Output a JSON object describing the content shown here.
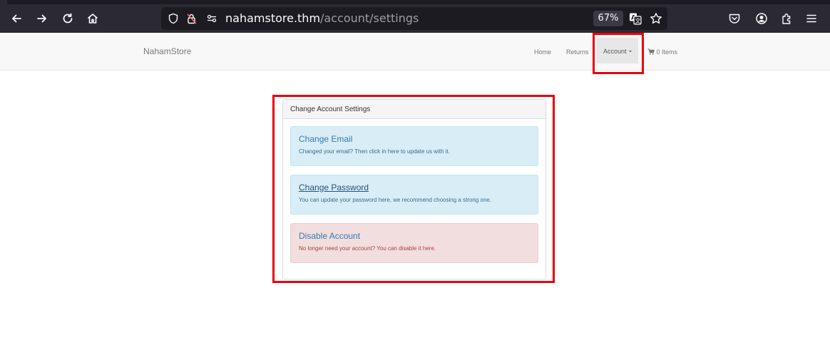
{
  "browser": {
    "url_host": "nahamstore.thm",
    "url_path": "/account/settings",
    "zoom": "67%"
  },
  "site": {
    "brand": "NahamStore",
    "nav": {
      "home": "Home",
      "returns": "Returns",
      "account": "Account",
      "basket": "0 Items"
    }
  },
  "panel": {
    "heading": "Change Account Settings",
    "options": [
      {
        "title": "Change Email",
        "description": "Changed your email? Then click in here to update us with it."
      },
      {
        "title": "Change Password",
        "description": "You can update your password here, we recommend choosing a strong one."
      },
      {
        "title": "Disable Account",
        "description": "No longer need your account? You can disable it here."
      }
    ]
  },
  "colors": {
    "annotation": "#e8000b",
    "info_bg": "#d9edf7",
    "danger_bg": "#f2dede",
    "link": "#337ab7"
  },
  "icons": [
    "back-icon",
    "forward-icon",
    "reload-icon",
    "home-icon",
    "shield-icon",
    "lock-warning-icon",
    "permissions-icon",
    "translate-icon",
    "bookmark-star-icon",
    "pocket-icon",
    "account-icon",
    "extensions-icon",
    "menu-icon",
    "cart-icon"
  ]
}
